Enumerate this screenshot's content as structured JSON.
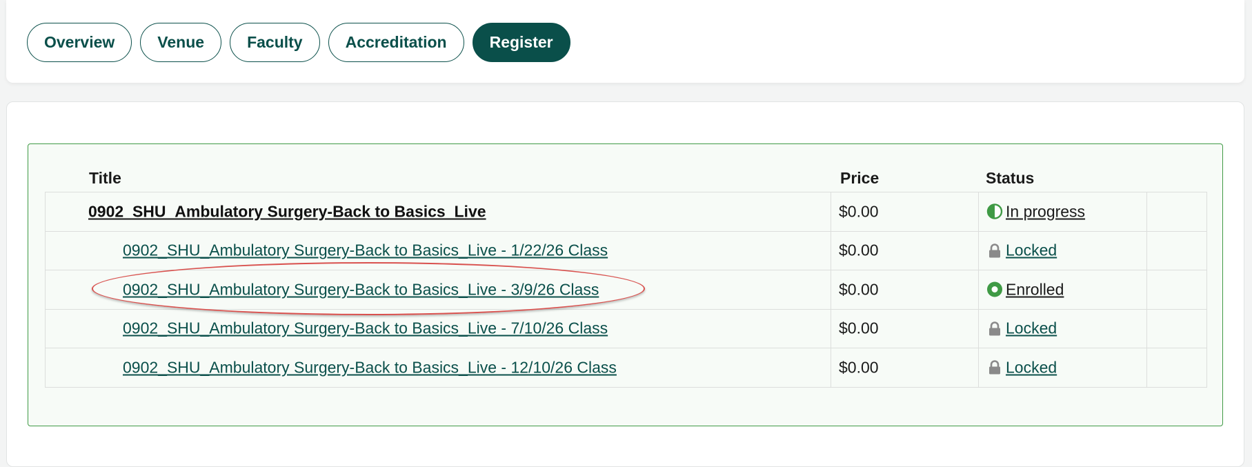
{
  "tabs": [
    {
      "label": "Overview",
      "active": false
    },
    {
      "label": "Venue",
      "active": false
    },
    {
      "label": "Faculty",
      "active": false
    },
    {
      "label": "Accreditation",
      "active": false
    },
    {
      "label": "Register",
      "active": true
    }
  ],
  "table": {
    "headers": {
      "title": "Title",
      "price": "Price",
      "status": "Status"
    },
    "rows": [
      {
        "title": "0902_SHU_Ambulatory Surgery-Back to Basics_Live",
        "price": "$0.00",
        "status": "In progress",
        "status_icon": "half-circle-icon",
        "level": "parent"
      },
      {
        "title": "0902_SHU_Ambulatory Surgery-Back to Basics_Live - 1/22/26 Class",
        "price": "$0.00",
        "status": "Locked",
        "status_icon": "lock-icon",
        "level": "child"
      },
      {
        "title": "0902_SHU_Ambulatory Surgery-Back to Basics_Live - 3/9/26 Class",
        "price": "$0.00",
        "status": "Enrolled",
        "status_icon": "enrolled-circle-icon",
        "level": "child"
      },
      {
        "title": "0902_SHU_Ambulatory Surgery-Back to Basics_Live - 7/10/26 Class",
        "price": "$0.00",
        "status": "Locked",
        "status_icon": "lock-icon",
        "level": "child"
      },
      {
        "title": "0902_SHU_Ambulatory Surgery-Back to Basics_Live - 12/10/26 Class",
        "price": "$0.00",
        "status": "Locked",
        "status_icon": "lock-icon",
        "level": "child"
      }
    ]
  },
  "colors": {
    "brand": "#0a4f4a",
    "status_green": "#3f9a45",
    "lock_gray": "#8a8a8a",
    "annotation_red": "#d9514e"
  }
}
